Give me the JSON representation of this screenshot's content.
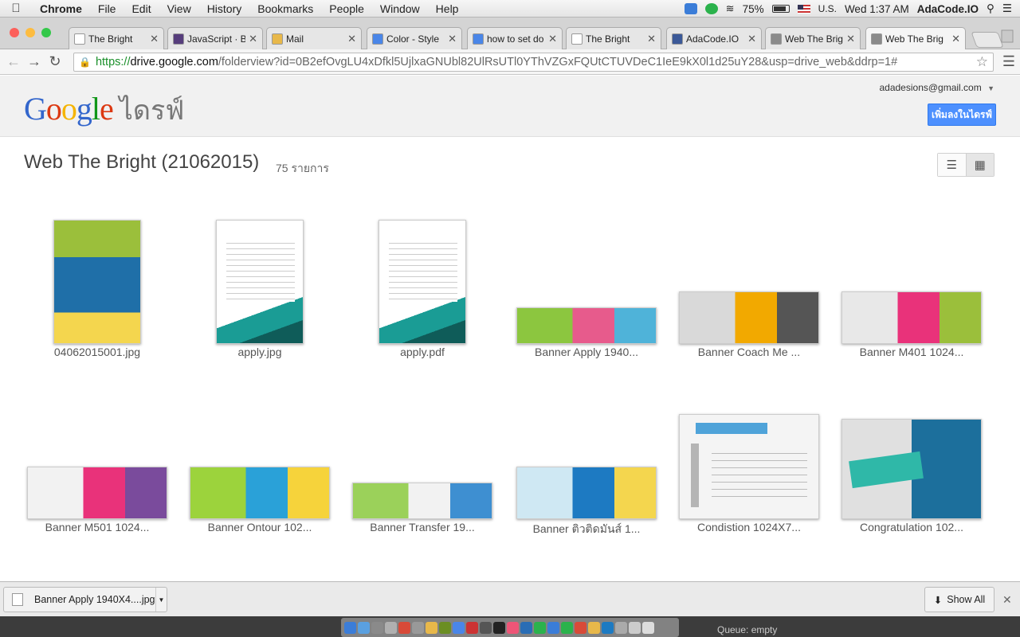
{
  "menubar": {
    "app_name": "Chrome",
    "items": [
      "File",
      "Edit",
      "View",
      "History",
      "Bookmarks",
      "People",
      "Window",
      "Help"
    ],
    "battery": "75%",
    "input_source": "U.S.",
    "clock": "Wed 1:37 AM",
    "user": "AdaCode.IO"
  },
  "tabs": [
    {
      "title": "The Bright",
      "icon": "page-icon",
      "color": "#ffffff"
    },
    {
      "title": "JavaScript · B",
      "icon": "bootstrap-icon",
      "color": "#563d7c"
    },
    {
      "title": "Mail",
      "icon": "mail-icon",
      "color": "#e8b84a"
    },
    {
      "title": "Color - Style",
      "icon": "google-icon",
      "color": "#4a86e8"
    },
    {
      "title": "how to set do",
      "icon": "google-icon",
      "color": "#4a86e8"
    },
    {
      "title": "The Bright",
      "icon": "page-icon",
      "color": "#ffffff"
    },
    {
      "title": "AdaCode.IO",
      "icon": "facebook-icon",
      "color": "#3b5998"
    },
    {
      "title": "Web The Brig",
      "icon": "drive-folder-icon",
      "color": "#8a8a8a"
    },
    {
      "title": "Web The Brig",
      "icon": "drive-folder-icon",
      "color": "#8a8a8a"
    }
  ],
  "omnibox": {
    "scheme": "https://",
    "host": "drive.google.com",
    "path": "/folderview?id=0B2efOvgLU4xDfkl5UjlxaGNUbl82UlRsUTl0YThVZGxFQUtCTUVDeC1IeE9kX0l1d25uY28&usp=drive_web&ddrp=1#"
  },
  "drive": {
    "logo_text": "Google",
    "product_name": "ไดรฟ์",
    "account_email": "adadesions@gmail.com",
    "add_to_drive_label": "เพิ่มลงในไดรฟ์"
  },
  "folder": {
    "title": "Web The Bright (21062015)",
    "count": "75 รายการ"
  },
  "files": [
    {
      "name": "04062015001.jpg",
      "kind": "portrait",
      "colors": [
        "#9bbf3b",
        "#1f6fa8",
        "#f4d64e"
      ]
    },
    {
      "name": "apply.jpg",
      "kind": "doc",
      "colors": [
        "#1a9c95",
        "#0f5c59",
        "#ffffff"
      ]
    },
    {
      "name": "apply.pdf",
      "kind": "doc",
      "colors": [
        "#1a9c95",
        "#0f5c59",
        "#ffffff"
      ]
    },
    {
      "name": "Banner Apply 1940...",
      "kind": "banner-low",
      "colors": [
        "#8cc63f",
        "#e75b8c",
        "#4fb3d9"
      ]
    },
    {
      "name": "Banner Coach Me ...",
      "kind": "banner-mid",
      "colors": [
        "#d9d9d9",
        "#f2a900",
        "#555555"
      ]
    },
    {
      "name": "Banner M401 1024...",
      "kind": "banner-mid",
      "colors": [
        "#e8e8e8",
        "#e9327a",
        "#9bbf3b"
      ]
    },
    {
      "name": "Banner M501 1024...",
      "kind": "banner-mid2",
      "colors": [
        "#f2f2f2",
        "#e9327a",
        "#7a4b9c"
      ]
    },
    {
      "name": "Banner Ontour 102...",
      "kind": "banner-mid2",
      "colors": [
        "#9cd33c",
        "#2aa1d8",
        "#f6d33b"
      ]
    },
    {
      "name": "Banner Transfer 19...",
      "kind": "banner-low2",
      "colors": [
        "#9bd15a",
        "#f2f2f2",
        "#3e8fd1"
      ]
    },
    {
      "name": "Banner ติวติดมันส์ 1...",
      "kind": "banner-mid2",
      "colors": [
        "#cfe8f3",
        "#1d7ac2",
        "#f4d64e"
      ]
    },
    {
      "name": "Condistion 1024X7...",
      "kind": "slide",
      "colors": [
        "#f4f4f4",
        "#4fa3d9",
        "#b5b5b5"
      ]
    },
    {
      "name": "Congratulation 102...",
      "kind": "slide2",
      "colors": [
        "#2fb8a8",
        "#e0e0e0",
        "#1c6f9c"
      ]
    }
  ],
  "download": {
    "file_label": "Banner Apply 1940X4....jpg",
    "show_all_label": "Show All"
  },
  "dock": {
    "status_text": "Queue: empty"
  }
}
